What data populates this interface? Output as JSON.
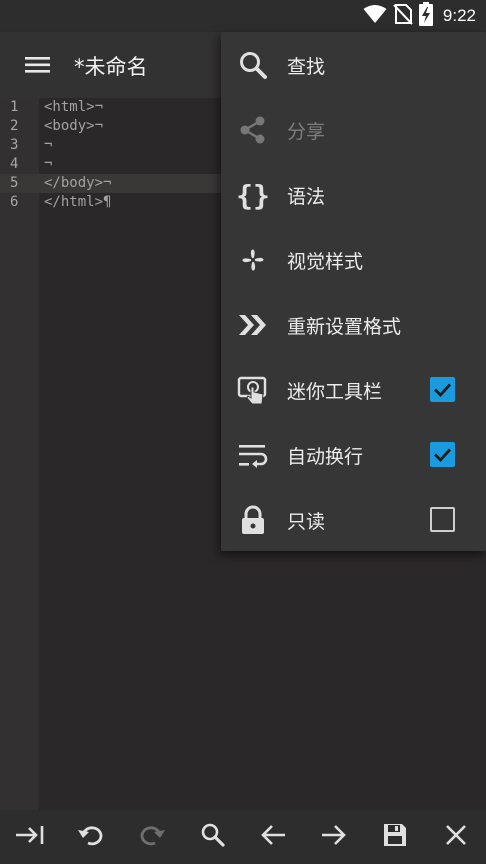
{
  "status_bar": {
    "time": "9:22",
    "icons": [
      "wifi-icon",
      "no-sim-icon",
      "battery-charging-icon"
    ]
  },
  "app_bar": {
    "menu_icon": "hamburger-icon",
    "title": "*未命名"
  },
  "editor": {
    "lines": [
      {
        "number": "1",
        "text": "<html>¬"
      },
      {
        "number": "2",
        "text": "<body>¬"
      },
      {
        "number": "3",
        "text": "¬"
      },
      {
        "number": "4",
        "text": "¬"
      },
      {
        "number": "5",
        "text": "</body>¬"
      },
      {
        "number": "6",
        "text": "</html>¶"
      }
    ],
    "active_line": 5
  },
  "menu": {
    "items": [
      {
        "label": "查找",
        "icon": "search-icon",
        "enabled": true
      },
      {
        "label": "分享",
        "icon": "share-icon",
        "enabled": false
      },
      {
        "label": "语法",
        "icon": "braces-icon",
        "enabled": true
      },
      {
        "label": "视觉样式",
        "icon": "pinwheel-icon",
        "enabled": true
      },
      {
        "label": "重新设置格式",
        "icon": "double-chevron-icon",
        "enabled": true
      },
      {
        "label": "迷你工具栏",
        "icon": "touch-screen-icon",
        "enabled": true,
        "checked": true
      },
      {
        "label": "自动换行",
        "icon": "wrap-text-icon",
        "enabled": true,
        "checked": true
      },
      {
        "label": "只读",
        "icon": "lock-icon",
        "enabled": true,
        "checked": false
      }
    ]
  },
  "bottom_toolbar": {
    "buttons": [
      "tab-icon",
      "undo-icon",
      "redo-icon",
      "search-icon",
      "arrow-left-icon",
      "arrow-right-icon",
      "save-icon",
      "close-icon"
    ],
    "redo_enabled": false
  },
  "colors": {
    "accent": "#1a9be0",
    "background": "#2b2829",
    "menu_background": "#363636",
    "toolbar": "#333232"
  }
}
